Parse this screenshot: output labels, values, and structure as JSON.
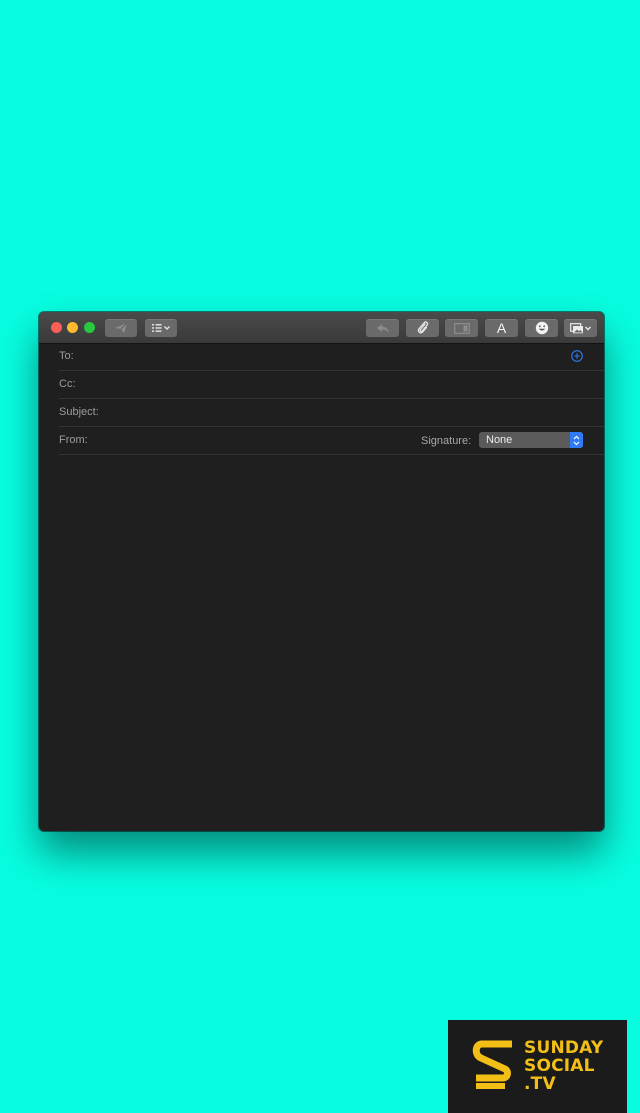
{
  "compose": {
    "fields": {
      "to_label": "To:",
      "cc_label": "Cc:",
      "subject_label": "Subject:",
      "from_label": "From:"
    },
    "signature": {
      "label": "Signature:",
      "value": "None"
    }
  },
  "toolbar": {
    "icons": [
      "send-icon",
      "header-fields-icon",
      "reply-icon",
      "attachment-icon",
      "sidebar-icon",
      "fonts-icon",
      "emoji-icon",
      "photo-browser-icon"
    ],
    "fonts_glyph": "A"
  },
  "colors": {
    "background": "#08fde0",
    "window": "#1f1f1f",
    "accent": "#2f7bf6",
    "logo_yellow": "#f3bf16"
  },
  "watermark": {
    "line1": "SUNDAY",
    "line2": "SOCIAL",
    "line3": ".TV"
  }
}
